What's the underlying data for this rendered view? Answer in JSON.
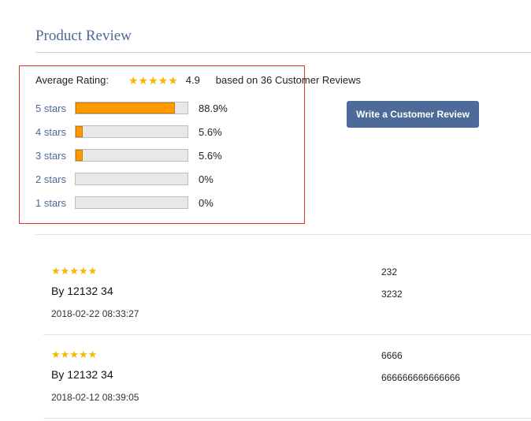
{
  "section_title": "Product Review",
  "summary": {
    "average_label": "Average Rating:",
    "average_value": "4.9",
    "average_star_count": 5,
    "based_on": "based on 36 Customer Reviews",
    "star_color": "#f5b800"
  },
  "distribution": [
    {
      "label": "5 stars",
      "percent_text": "88.9%",
      "fill_fraction": 0.889
    },
    {
      "label": "4 stars",
      "percent_text": "5.6%",
      "fill_fraction": 0.056
    },
    {
      "label": "3 stars",
      "percent_text": "5.6%",
      "fill_fraction": 0.056
    },
    {
      "label": "2 stars",
      "percent_text": "0%",
      "fill_fraction": 0
    },
    {
      "label": "1 stars",
      "percent_text": "0%",
      "fill_fraction": 0
    }
  ],
  "write_review_button": "Write a Customer Review",
  "reviews": [
    {
      "stars": 5,
      "author": "By 12132 34",
      "date": "2018-02-22 08:33:27",
      "title": "232",
      "body": "3232"
    },
    {
      "stars": 5,
      "author": "By 12132 34",
      "date": "2018-02-12 08:39:05",
      "title": "6666",
      "body": "666666666666666"
    }
  ],
  "colors": {
    "accent": "#4a6a96",
    "bar_fill": "#ff9a00",
    "button": "#4d6b98",
    "highlight": "#e03030"
  }
}
